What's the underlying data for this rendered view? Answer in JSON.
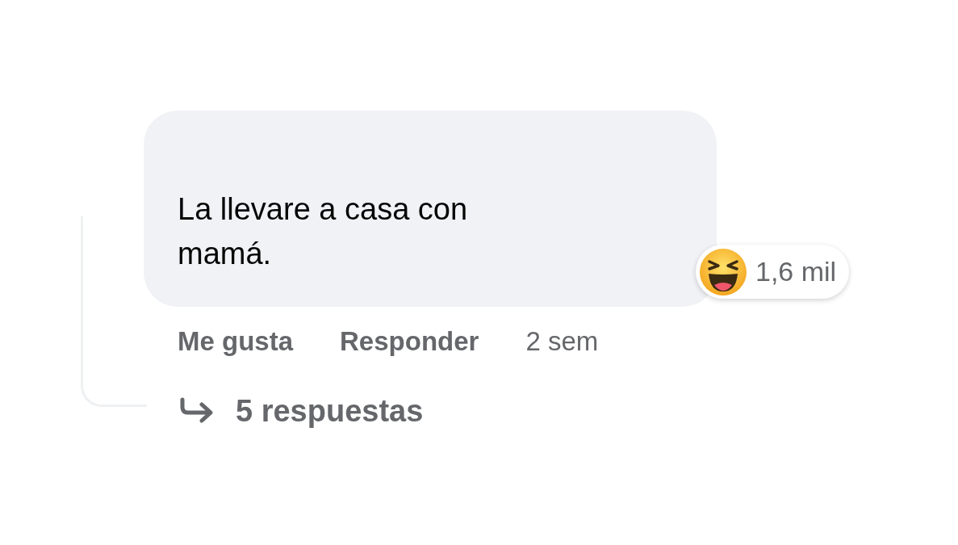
{
  "comment": {
    "text": "La llevare a casa con mamá.",
    "reactions": {
      "count": "1,6 mil"
    }
  },
  "actions": [
    {
      "label": "Me gusta"
    },
    {
      "label": "Responder"
    }
  ],
  "time": "2 sem",
  "replies": {
    "label": "5 respuestas"
  }
}
